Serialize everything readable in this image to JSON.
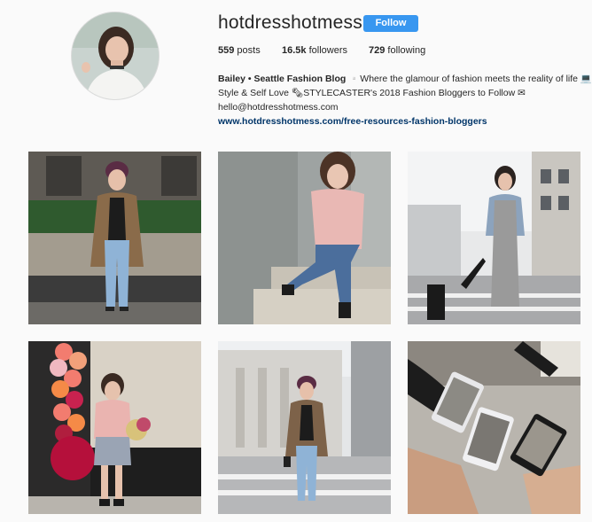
{
  "profile": {
    "username": "hotdresshotmess",
    "follow_label": "Follow",
    "stats": {
      "posts_count": "559",
      "posts_label": "posts",
      "followers_count": "16.5k",
      "followers_label": "followers",
      "following_count": "729",
      "following_label": "following"
    },
    "bio": {
      "name": "Bailey • Seattle Fashion Blog",
      "line1": "▫️Where the glamour of fashion meets the reality of life 💻",
      "line2": "Style & Self Love 🗞STYLECASTER's 2018 Fashion Bloggers to Follow ✉",
      "email": "hello@hotdresshotmess.com",
      "website": "www.hotdresshotmess.com/free-resources-fashion-bloggers"
    }
  },
  "posts": [
    {
      "subject": "leopard-coat-street"
    },
    {
      "subject": "pink-sweater-steps"
    },
    {
      "subject": "grey-dress-crosswalk"
    },
    {
      "subject": "balloons-storefront"
    },
    {
      "subject": "leopard-coat-crosswalk"
    },
    {
      "subject": "phones-flatlay"
    }
  ]
}
